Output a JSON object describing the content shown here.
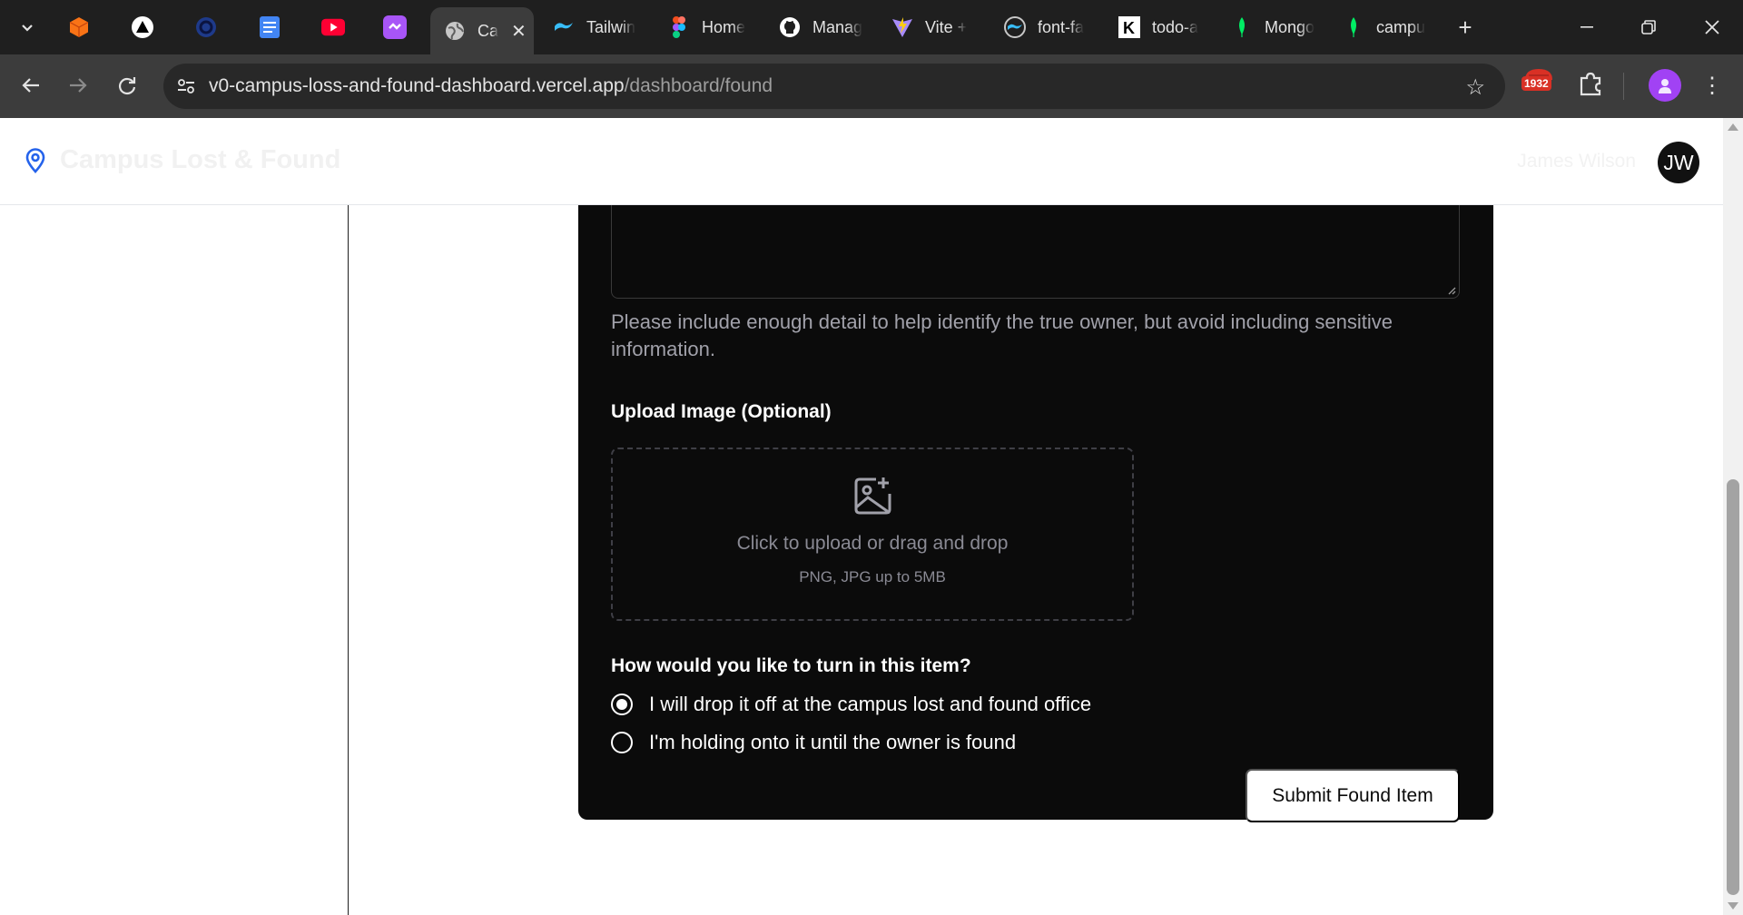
{
  "browser": {
    "tabs": [
      {
        "label": "",
        "icon": "orange-cube-icon",
        "active": false
      },
      {
        "label": "",
        "icon": "triangle-logo-icon",
        "active": false
      },
      {
        "label": "",
        "icon": "blue-ring-icon",
        "active": false
      },
      {
        "label": "",
        "icon": "docs-icon",
        "active": false
      },
      {
        "label": "",
        "icon": "youtube-icon",
        "active": false
      },
      {
        "label": "",
        "icon": "purple-app-icon",
        "active": false
      },
      {
        "label": "Ca",
        "icon": "globe-icon",
        "active": true
      },
      {
        "label": "Tailwin",
        "icon": "tailwind-icon",
        "active": false
      },
      {
        "label": "Home",
        "icon": "figma-icon",
        "active": false
      },
      {
        "label": "Manag",
        "icon": "github-icon",
        "active": false
      },
      {
        "label": "Vite +",
        "icon": "vite-icon",
        "active": false
      },
      {
        "label": "font-fa",
        "icon": "tailwind-icon",
        "active": false
      },
      {
        "label": "todo-a",
        "icon": "k-logo-icon",
        "active": false
      },
      {
        "label": "Mongo",
        "icon": "mongodb-leaf-icon",
        "active": false
      },
      {
        "label": "campu",
        "icon": "mongodb-leaf-icon",
        "active": false
      }
    ],
    "url_host": "v0-campus-loss-and-found-dashboard.vercel.app",
    "url_path": "/dashboard/found",
    "extension_badge": "1932"
  },
  "app": {
    "title": "Campus Lost & Found",
    "user_name": "James Wilson",
    "avatar_initials": "JW"
  },
  "form": {
    "help_text": "Please include enough detail to help identify the true owner, but avoid including sensitive information.",
    "upload_label": "Upload Image (Optional)",
    "upload_main": "Click to upload or drag and drop",
    "upload_sub": "PNG, JPG up to 5MB",
    "turnin_question": "How would you like to turn in this item?",
    "options": [
      {
        "label": "I will drop it off at the campus lost and found office",
        "selected": true
      },
      {
        "label": "I'm holding onto it until the owner is found",
        "selected": false
      }
    ],
    "submit_label": "Submit Found Item"
  },
  "colors": {
    "card_bg": "#0b0b0b",
    "muted_text": "#a1a1aa",
    "accent_blue": "#2563eb"
  }
}
